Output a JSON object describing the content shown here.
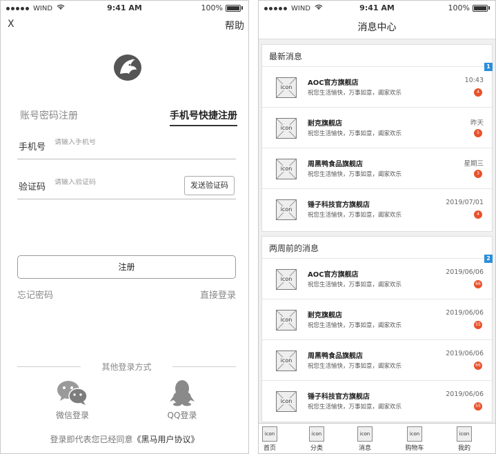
{
  "status_bar": {
    "carrier": "WIND",
    "time": "9:41 AM",
    "battery": "100%"
  },
  "login": {
    "close": "X",
    "help": "帮助",
    "tabs": {
      "account": "账号密码注册",
      "phone": "手机号快捷注册"
    },
    "phone_field": {
      "label": "手机号",
      "placeholder": "请输入手机号"
    },
    "code_field": {
      "label": "验证码",
      "placeholder": "请输入验证码",
      "button": "发送验证码"
    },
    "register_button": "注册",
    "forgot_password": "忘记密码",
    "direct_login": "直接登录",
    "other_methods": "其他登录方式",
    "wechat_login": "微信登录",
    "qq_login": "QQ登录",
    "agreement_prefix": "登录即代表您已经同意",
    "agreement_link": "《黑马用户协议》"
  },
  "messages": {
    "title": "消息中心",
    "sections": [
      {
        "heading": "最新消息",
        "badge": "1",
        "items": [
          {
            "icon": "icon",
            "name": "AOC官方旗舰店",
            "text": "祝您生活愉快，万事如意，阖家欢乐",
            "time": "10:43",
            "count": "4"
          },
          {
            "icon": "icon",
            "name": "耐克旗舰店",
            "text": "祝您生活愉快，万事如意，阖家欢乐",
            "time": "昨天",
            "count": "5"
          },
          {
            "icon": "icon",
            "name": "周黑鸭食品旗舰店",
            "text": "祝您生活愉快，万事如意，阖家欢乐",
            "time": "星期三",
            "count": "3"
          },
          {
            "icon": "icon",
            "name": "锤子科技官方旗舰店",
            "text": "祝您生活愉快，万事如意，阖家欢乐",
            "time": "2019/07/01",
            "count": "4"
          }
        ]
      },
      {
        "heading": "两周前的消息",
        "badge": "2",
        "items": [
          {
            "icon": "icon",
            "name": "AOC官方旗舰店",
            "text": "祝您生活愉快，万事如意，阖家欢乐",
            "time": "2019/06/06",
            "count": "66"
          },
          {
            "icon": "icon",
            "name": "耐克旗舰店",
            "text": "祝您生活愉快，万事如意，阖家欢乐",
            "time": "2019/06/06",
            "count": "55"
          },
          {
            "icon": "icon",
            "name": "周黑鸭食品旗舰店",
            "text": "祝您生活愉快，万事如意，阖家欢乐",
            "time": "2019/06/06",
            "count": "66"
          },
          {
            "icon": "icon",
            "name": "锤子科技官方旗舰店",
            "text": "祝您生活愉快，万事如意，阖家欢乐",
            "time": "2019/06/06",
            "count": "55"
          }
        ]
      }
    ],
    "tabbar": [
      {
        "icon": "icon",
        "label": "首页"
      },
      {
        "icon": "icon",
        "label": "分类"
      },
      {
        "icon": "icon",
        "label": "消息"
      },
      {
        "icon": "icon",
        "label": "购物车"
      },
      {
        "icon": "icon",
        "label": "我的"
      }
    ]
  },
  "colors": {
    "accent_blue": "#2a8fd8",
    "badge_red": "#e8522c"
  }
}
